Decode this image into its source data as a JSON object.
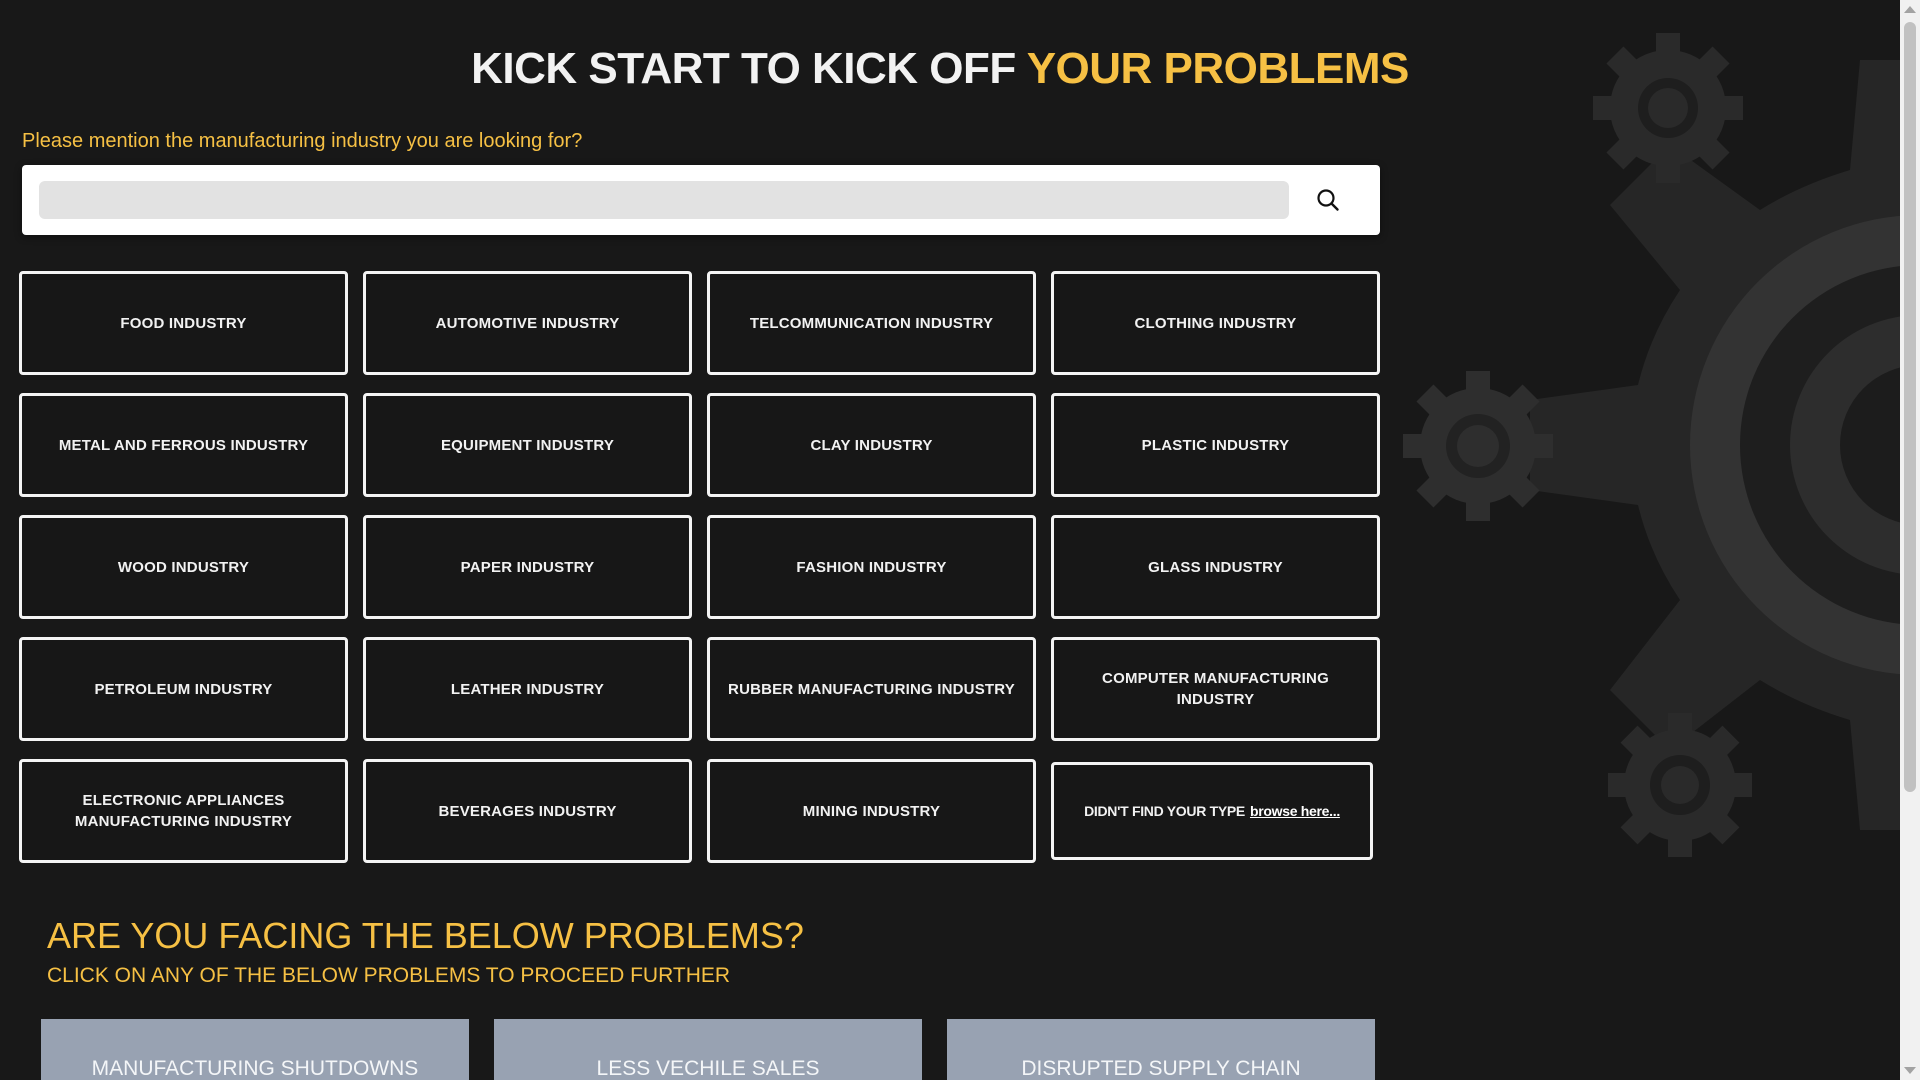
{
  "hero": {
    "title_main": "KICK START TO KICK OFF",
    "title_accent": "YOUR PROBLEMS"
  },
  "search": {
    "prompt": "Please mention the manufacturing industry you are looking for?",
    "value": "",
    "placeholder": "",
    "button_icon": "search-icon"
  },
  "industries": [
    "FOOD INDUSTRY",
    "AUTOMOTIVE INDUSTRY",
    "TELCOMMUNICATION INDUSTRY",
    "CLOTHING INDUSTRY",
    "METAL AND FERROUS INDUSTRY",
    "EQUIPMENT INDUSTRY",
    "CLAY INDUSTRY",
    "PLASTIC INDUSTRY",
    "WOOD INDUSTRY",
    "PAPER INDUSTRY",
    "FASHION INDUSTRY",
    "GLASS INDUSTRY",
    "PETROLEUM INDUSTRY",
    "LEATHER INDUSTRY",
    "RUBBER MANUFACTURING INDUSTRY",
    "COMPUTER MANUFACTURING INDUSTRY",
    "ELECTRONIC APPLIANCES MANUFACTURING INDUSTRY",
    "BEVERAGES INDUSTRY",
    "MINING INDUSTRY"
  ],
  "browse": {
    "text": "DIDN'T FIND YOUR TYPE",
    "link": "browse here..."
  },
  "problems": {
    "heading": "ARE YOU FACING THE BELOW PROBLEMS?",
    "subheading": "CLICK ON ANY OF THE BELOW PROBLEMS TO PROCEED FURTHER",
    "cards": [
      "MANUFACTURING SHUTDOWNS",
      "LESS VECHILE SALES",
      "DISRUPTED SUPPLY CHAIN"
    ]
  },
  "colors": {
    "background": "#181818",
    "accent": "#f6c044",
    "tile_border": "#f4f4f4",
    "problem_card": "#98a2b2",
    "gear": "#2c2c2c"
  }
}
